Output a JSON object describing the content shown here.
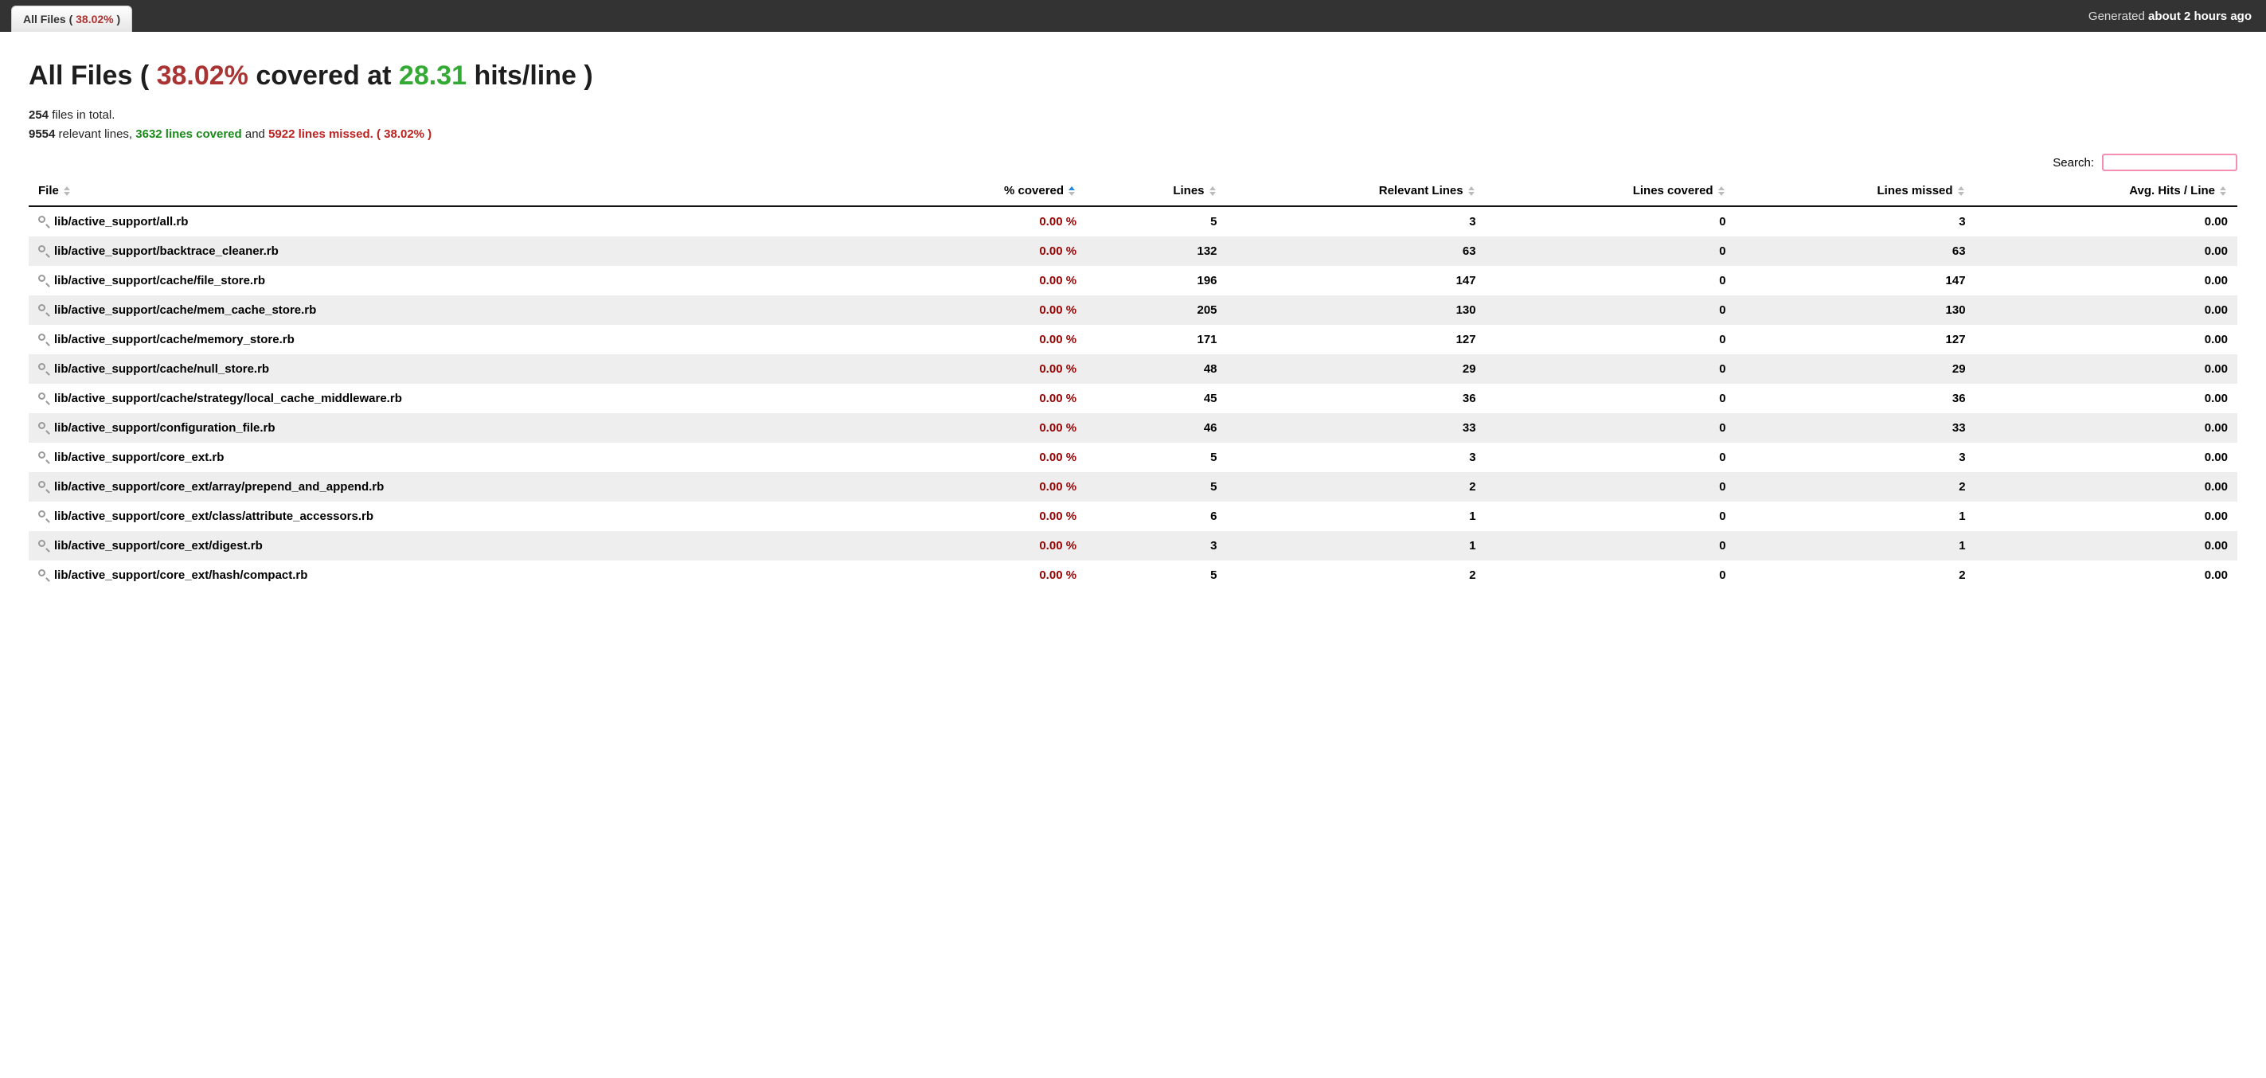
{
  "tab": {
    "label_prefix": "All Files ( ",
    "pct": "38.02%",
    "label_suffix": " )"
  },
  "generated": {
    "prefix": "Generated ",
    "time": "about 2 hours ago"
  },
  "title": {
    "prefix": "All Files ( ",
    "pct": "38.02%",
    "mid": " covered at ",
    "hits": "28.31",
    "suffix": " hits/line )"
  },
  "summary1": {
    "count": "254",
    "text": " files in total."
  },
  "summary2": {
    "relevant": "9554",
    "relevant_text": " relevant lines, ",
    "covered": "3632 lines covered",
    "and": " and ",
    "missed": "5922 lines missed.",
    "pct": " ( 38.02% )"
  },
  "search_label": "Search:",
  "headers": {
    "file": "File",
    "pct": "% covered",
    "lines": "Lines",
    "relevant": "Relevant Lines",
    "covered": "Lines covered",
    "missed": "Lines missed",
    "avg": "Avg. Hits / Line"
  },
  "rows": [
    {
      "file": "lib/active_support/all.rb",
      "pct": "0.00 %",
      "lines": "5",
      "relevant": "3",
      "covered": "0",
      "missed": "3",
      "avg": "0.00"
    },
    {
      "file": "lib/active_support/backtrace_cleaner.rb",
      "pct": "0.00 %",
      "lines": "132",
      "relevant": "63",
      "covered": "0",
      "missed": "63",
      "avg": "0.00"
    },
    {
      "file": "lib/active_support/cache/file_store.rb",
      "pct": "0.00 %",
      "lines": "196",
      "relevant": "147",
      "covered": "0",
      "missed": "147",
      "avg": "0.00"
    },
    {
      "file": "lib/active_support/cache/mem_cache_store.rb",
      "pct": "0.00 %",
      "lines": "205",
      "relevant": "130",
      "covered": "0",
      "missed": "130",
      "avg": "0.00"
    },
    {
      "file": "lib/active_support/cache/memory_store.rb",
      "pct": "0.00 %",
      "lines": "171",
      "relevant": "127",
      "covered": "0",
      "missed": "127",
      "avg": "0.00"
    },
    {
      "file": "lib/active_support/cache/null_store.rb",
      "pct": "0.00 %",
      "lines": "48",
      "relevant": "29",
      "covered": "0",
      "missed": "29",
      "avg": "0.00"
    },
    {
      "file": "lib/active_support/cache/strategy/local_cache_middleware.rb",
      "pct": "0.00 %",
      "lines": "45",
      "relevant": "36",
      "covered": "0",
      "missed": "36",
      "avg": "0.00"
    },
    {
      "file": "lib/active_support/configuration_file.rb",
      "pct": "0.00 %",
      "lines": "46",
      "relevant": "33",
      "covered": "0",
      "missed": "33",
      "avg": "0.00"
    },
    {
      "file": "lib/active_support/core_ext.rb",
      "pct": "0.00 %",
      "lines": "5",
      "relevant": "3",
      "covered": "0",
      "missed": "3",
      "avg": "0.00"
    },
    {
      "file": "lib/active_support/core_ext/array/prepend_and_append.rb",
      "pct": "0.00 %",
      "lines": "5",
      "relevant": "2",
      "covered": "0",
      "missed": "2",
      "avg": "0.00"
    },
    {
      "file": "lib/active_support/core_ext/class/attribute_accessors.rb",
      "pct": "0.00 %",
      "lines": "6",
      "relevant": "1",
      "covered": "0",
      "missed": "1",
      "avg": "0.00"
    },
    {
      "file": "lib/active_support/core_ext/digest.rb",
      "pct": "0.00 %",
      "lines": "3",
      "relevant": "1",
      "covered": "0",
      "missed": "1",
      "avg": "0.00"
    },
    {
      "file": "lib/active_support/core_ext/hash/compact.rb",
      "pct": "0.00 %",
      "lines": "5",
      "relevant": "2",
      "covered": "0",
      "missed": "2",
      "avg": "0.00"
    }
  ]
}
